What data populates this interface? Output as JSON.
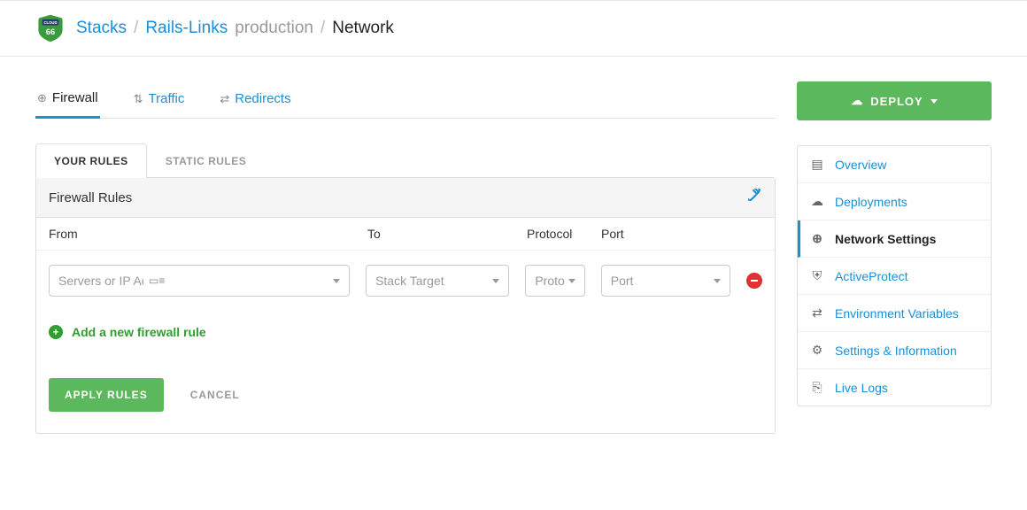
{
  "breadcrumb": {
    "root": "Stacks",
    "stack": "Rails-Links",
    "env": "production",
    "current": "Network"
  },
  "primary_tabs": {
    "firewall": "Firewall",
    "traffic": "Traffic",
    "redirects": "Redirects"
  },
  "sub_tabs": {
    "your_rules": "YOUR RULES",
    "static_rules": "STATIC RULES"
  },
  "panel": {
    "title": "Firewall Rules",
    "columns": {
      "from": "From",
      "to": "To",
      "protocol": "Protocol",
      "port": "Port"
    },
    "row": {
      "from_placeholder": "Servers or IP Addresses",
      "to_placeholder": "Stack Target",
      "proto_placeholder": "Proto",
      "port_placeholder": "Port"
    },
    "add_rule": "Add a new firewall rule",
    "apply": "APPLY RULES",
    "cancel": "CANCEL"
  },
  "deploy_label": "DEPLOY",
  "sidenav": {
    "overview": "Overview",
    "deployments": "Deployments",
    "network": "Network Settings",
    "activeprotect": "ActiveProtect",
    "envvars": "Environment Variables",
    "settings": "Settings & Information",
    "logs": "Live Logs"
  }
}
